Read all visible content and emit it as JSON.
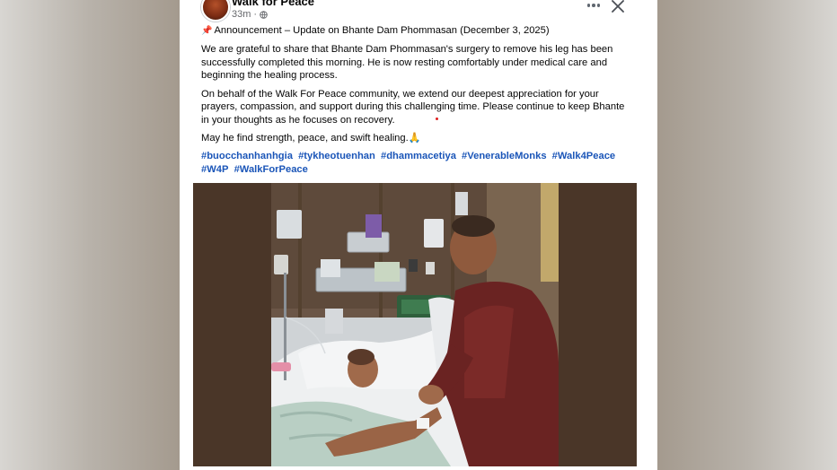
{
  "page": {
    "name": "Walk for Peace",
    "time": "33m",
    "audience_icon": "globe-icon"
  },
  "actions": {
    "more_icon": "more-horizontal-icon",
    "close_icon": "close-icon"
  },
  "post": {
    "announcement": "Announcement – Update on Bhante Dam Phommasan (December 3, 2025)",
    "announcement_icon": "📌",
    "paragraphs": [
      "We are grateful to share that Bhante Dam Phommasan's surgery to remove his leg has been successfully completed this morning. He is now resting comfortably under medical care and beginning the healing process.",
      "On behalf of the Walk For Peace community, we extend our deepest appreciation for your prayers, compassion, and support during this challenging time. Please continue to keep Bhante in your thoughts as he focuses on recovery.",
      "May he find strength, peace, and swift healing.🙏"
    ],
    "hashtags": [
      "#buocchanhanhgia",
      "#tykheotuenhan",
      "#dhammacetiya",
      "#VenerableMonks",
      "#Walk4Peace",
      "#W4P",
      "#WalkForPeace"
    ]
  },
  "photo": {
    "subject": "hospital-room-photo"
  },
  "colors": {
    "link": "#1a55b8",
    "meta": "#65676b",
    "text": "#050505"
  }
}
